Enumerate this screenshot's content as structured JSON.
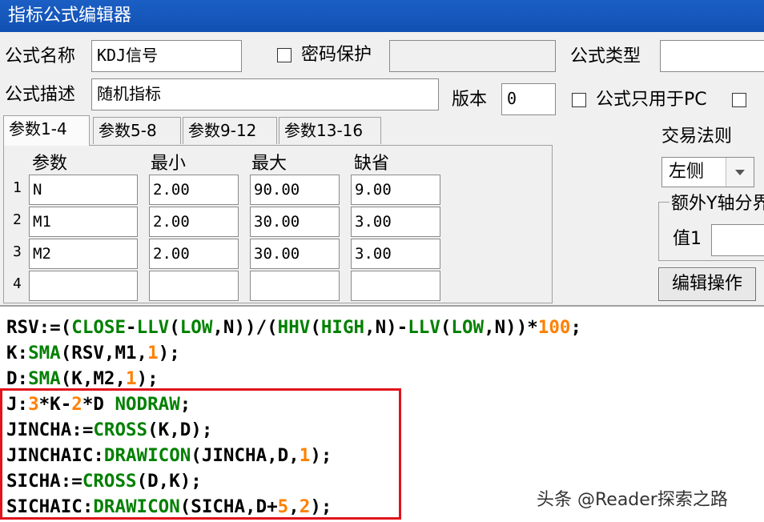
{
  "window": {
    "title": "指标公式编辑器"
  },
  "form": {
    "name_label": "公式名称",
    "name_value": "KDJ信号",
    "password_label": "密码保护",
    "type_label": "公式类型",
    "desc_label": "公式描述",
    "desc_value": "随机指标",
    "version_label": "版本",
    "version_value": "0",
    "pc_only_label": "公式只用于PC",
    "pc_only_checked": false,
    "password_checked": false
  },
  "tabs": [
    {
      "label": "参数1-4",
      "active": true
    },
    {
      "label": "参数5-8",
      "active": false
    },
    {
      "label": "参数9-12",
      "active": false
    },
    {
      "label": "参数13-16",
      "active": false
    }
  ],
  "params": {
    "headers": [
      "参数",
      "最小",
      "最大",
      "缺省"
    ],
    "rows": [
      {
        "no": "1",
        "name": "N",
        "min": "2.00",
        "max": "90.00",
        "default": "9.00"
      },
      {
        "no": "2",
        "name": "M1",
        "min": "2.00",
        "max": "30.00",
        "default": "3.00"
      },
      {
        "no": "3",
        "name": "M2",
        "min": "2.00",
        "max": "30.00",
        "default": "3.00"
      },
      {
        "no": "4",
        "name": "",
        "min": "",
        "max": "",
        "default": ""
      }
    ]
  },
  "side": {
    "trade_rule_label": "交易法则",
    "trade_rule_value": "左侧",
    "extra_y_label": "额外Y轴分界",
    "value1_label": "值1",
    "edit_button": "编辑操作"
  },
  "code_lines": [
    "RSV:=(CLOSE-LLV(LOW,N))/(HHV(HIGH,N)-LLV(LOW,N))*100;",
    "K:SMA(RSV,M1,1);",
    "D:SMA(K,M2,1);",
    "J:3*K-2*D NODRAW;",
    "JINCHA:=CROSS(K,D);",
    "JINCHAIC:DRAWICON(JINCHA,D,1);",
    "SICHA:=CROSS(D,K);",
    "SICHAIC:DRAWICON(SICHA,D+5,2);"
  ],
  "watermark": "头条 @Reader探索之路",
  "colors": {
    "title_bar": "#1150b3",
    "function": "#008000",
    "number": "#ff8000",
    "highlight_box": "#e0141c"
  }
}
